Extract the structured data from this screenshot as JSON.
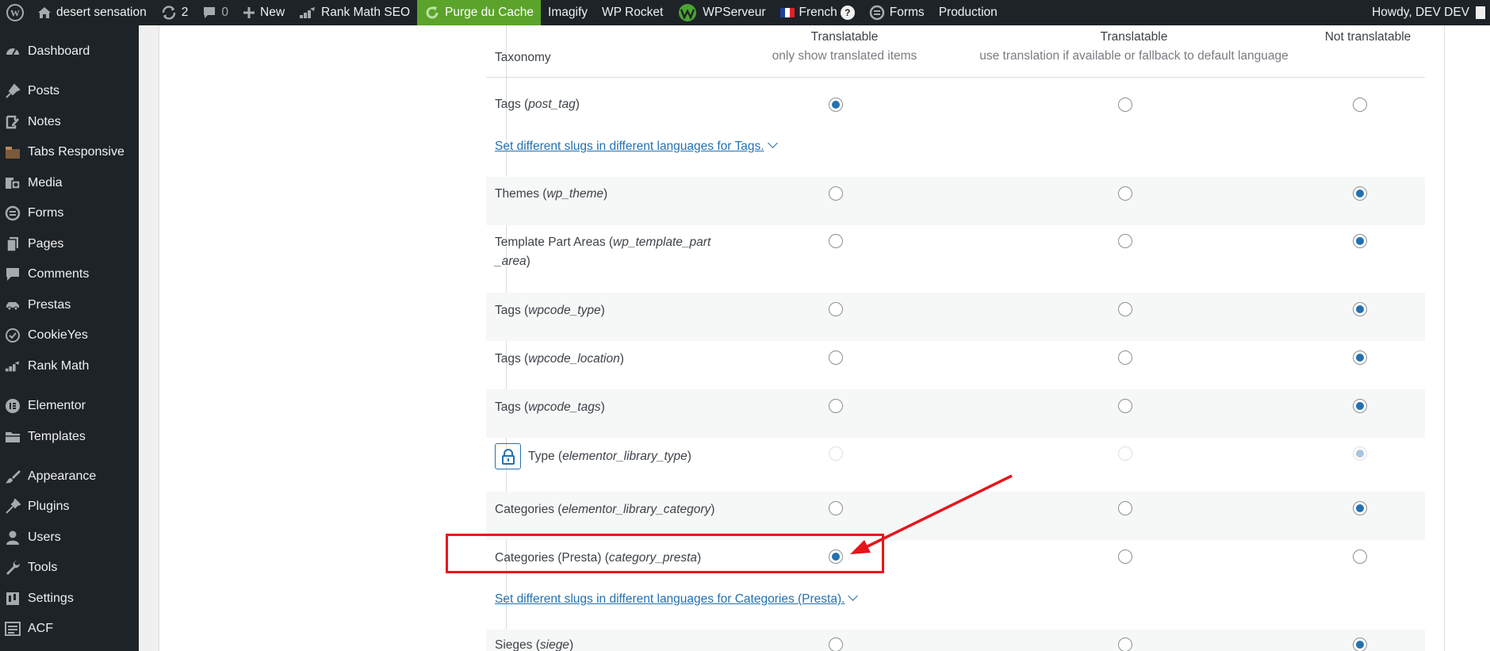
{
  "adminbar": {
    "site_name": "desert sensation",
    "updates_count": "2",
    "comments_count": "0",
    "new_label": "New",
    "rankmath_label": "Rank Math SEO",
    "purge_label": "Purge du Cache",
    "imagify_label": "Imagify",
    "wprocket_label": "WP Rocket",
    "wpserveur_label": "WPServeur",
    "language_label": "French",
    "forms_label": "Forms",
    "production_label": "Production",
    "greeting": "Howdy, DEV DEV"
  },
  "sidebar": {
    "items": [
      {
        "label": "Dashboard",
        "icon": "dashboard-icon"
      },
      {
        "label": "Posts",
        "icon": "pin-icon"
      },
      {
        "label": "Notes",
        "icon": "note-icon"
      },
      {
        "label": "Tabs Responsive",
        "icon": "tabs-icon"
      },
      {
        "label": "Media",
        "icon": "media-icon"
      },
      {
        "label": "Forms",
        "icon": "forms-icon"
      },
      {
        "label": "Pages",
        "icon": "pages-icon"
      },
      {
        "label": "Comments",
        "icon": "comments-icon"
      },
      {
        "label": "Prestas",
        "icon": "car-icon"
      },
      {
        "label": "CookieYes",
        "icon": "cookieyes-icon"
      },
      {
        "label": "Rank Math",
        "icon": "rankmath-icon"
      },
      {
        "label": "Elementor",
        "icon": "elementor-icon"
      },
      {
        "label": "Templates",
        "icon": "folder-icon"
      },
      {
        "label": "Appearance",
        "icon": "brush-icon"
      },
      {
        "label": "Plugins",
        "icon": "plugin-icon"
      },
      {
        "label": "Users",
        "icon": "user-icon"
      },
      {
        "label": "Tools",
        "icon": "wrench-icon"
      },
      {
        "label": "Settings",
        "icon": "settings-icon"
      },
      {
        "label": "ACF",
        "icon": "acf-icon"
      }
    ]
  },
  "table": {
    "headers": {
      "taxonomy": "Taxonomy",
      "col1_title": "Translatable",
      "col1_sub": "only show translated items",
      "col2_title": "Translatable",
      "col2_sub": "use translation if available or fallback to default language",
      "col3_title": "Not translatable"
    },
    "rows": [
      {
        "name": "Tags (",
        "slug": "post_tag",
        "close": ")",
        "selected": 1
      },
      {
        "name": "Themes (",
        "slug": "wp_theme",
        "close": ")",
        "selected": 3
      },
      {
        "name": "Template Part Areas (",
        "slug": "wp_template_part",
        "close": "",
        "line2_slug": "_area",
        "line2_close": ")",
        "selected": 3
      },
      {
        "name": "Tags (",
        "slug": "wpcode_type",
        "close": ")",
        "selected": 3
      },
      {
        "name": "Tags (",
        "slug": "wpcode_location",
        "close": ")",
        "selected": 3
      },
      {
        "name": "Tags (",
        "slug": "wpcode_tags",
        "close": ")",
        "selected": 3
      },
      {
        "name": "Type (",
        "slug": "elementor_library_type",
        "close": ")",
        "selected": 3,
        "locked": true
      },
      {
        "name": "Categories (",
        "slug": "elementor_library_category",
        "close": ")",
        "selected": 3
      },
      {
        "name": "Categories (Presta) (",
        "slug": "category_presta",
        "close": ")",
        "selected": 1
      },
      {
        "name": "Sieges (",
        "slug": "siege",
        "close": ")",
        "selected": 3
      }
    ],
    "slug_links": {
      "tags": "Set different slugs in different languages for Tags.",
      "categories_presta": "Set different slugs in different languages for Categories (Presta)."
    }
  },
  "annotation": {
    "color": "#e8141b"
  }
}
